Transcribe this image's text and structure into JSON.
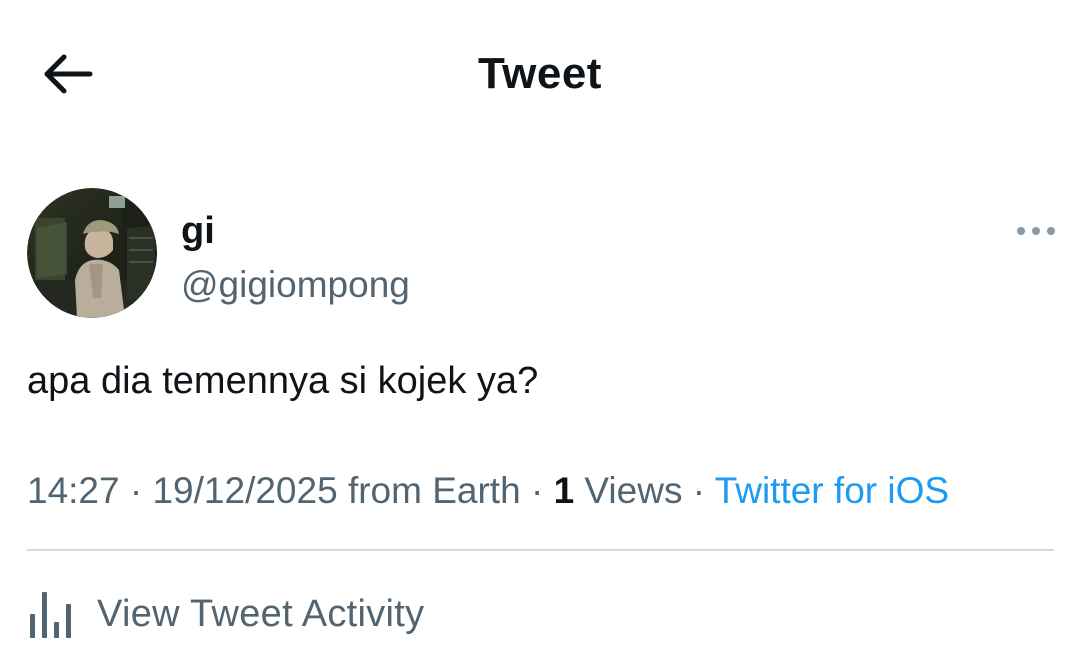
{
  "header": {
    "title": "Tweet",
    "back_icon": "arrow-left-icon"
  },
  "tweet": {
    "author": {
      "display_name": "gi",
      "handle": "@gigiompong",
      "avatar_icon": "avatar-photo"
    },
    "more_icon": "more-horizontal-icon",
    "text": "apa dia temennya si kojek ya?",
    "meta": {
      "time": "14:27",
      "sep1": " · ",
      "date_location": "19/12/2025 from Earth",
      "sep2": " · ",
      "views_count": "1",
      "views_label": " Views",
      "sep3": " · ",
      "source": "Twitter for iOS"
    },
    "activity": {
      "icon": "analytics-bars-icon",
      "label": "View Tweet Activity"
    }
  },
  "colors": {
    "text_primary": "#0f1419",
    "text_secondary": "#536471",
    "link": "#1d9bf0",
    "divider": "#cfd9de"
  }
}
